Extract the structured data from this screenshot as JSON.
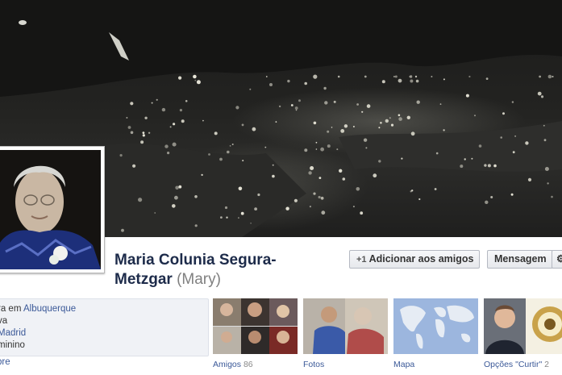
{
  "profile": {
    "name": "Maria Colunia Segura-Metzgar",
    "alternate_name": "(Mary)",
    "cover_photo_icon": "night-town-photo",
    "profile_photo_icon": "elderly-woman-portrait-photo"
  },
  "actions": {
    "add_friend_icon": "add-friend-icon",
    "add_friend_label": "Adicionar aos amigos",
    "message_label": "Mensagem",
    "more_label": "⚙"
  },
  "info": {
    "lives_prefix": "ra em",
    "lives_city": "Albuquerque",
    "relationship": "va",
    "hometown": "Madrid",
    "gender": "minino",
    "about_link": "bre"
  },
  "tiles": {
    "friends_label": "Amigos",
    "friends_count": "86",
    "photos_label": "Fotos",
    "map_label": "Mapa",
    "likes_label": "Opções \"Curtir\"",
    "likes_count": "2"
  },
  "colors": {
    "link": "#3b5998",
    "name": "#1d2b4a",
    "info_bg": "#f0f2f6"
  }
}
